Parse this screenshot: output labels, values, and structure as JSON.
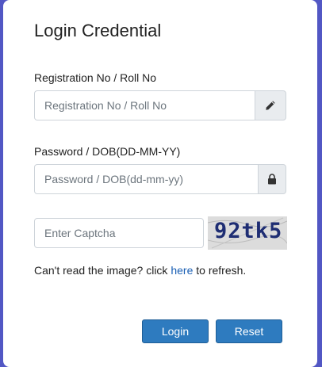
{
  "form": {
    "title": "Login Credential",
    "registration": {
      "label": "Registration No / Roll No",
      "placeholder": "Registration No / Roll No",
      "icon": "pencil-icon"
    },
    "password": {
      "label": "Password / DOB(DD-MM-YY)",
      "placeholder": "Password / DOB(dd-mm-yy)",
      "icon": "lock-icon"
    },
    "captcha": {
      "placeholder": "Enter Captcha",
      "image_text": "92tk5"
    },
    "hint": {
      "prefix": "Can't read the image? click ",
      "link": "here",
      "suffix": " to refresh."
    },
    "buttons": {
      "login": "Login",
      "reset": "Reset"
    }
  },
  "colors": {
    "background": "#5257c4",
    "button": "#2e7bbf",
    "link": "#1a5fb4",
    "captcha_text": "#1e2d73"
  }
}
